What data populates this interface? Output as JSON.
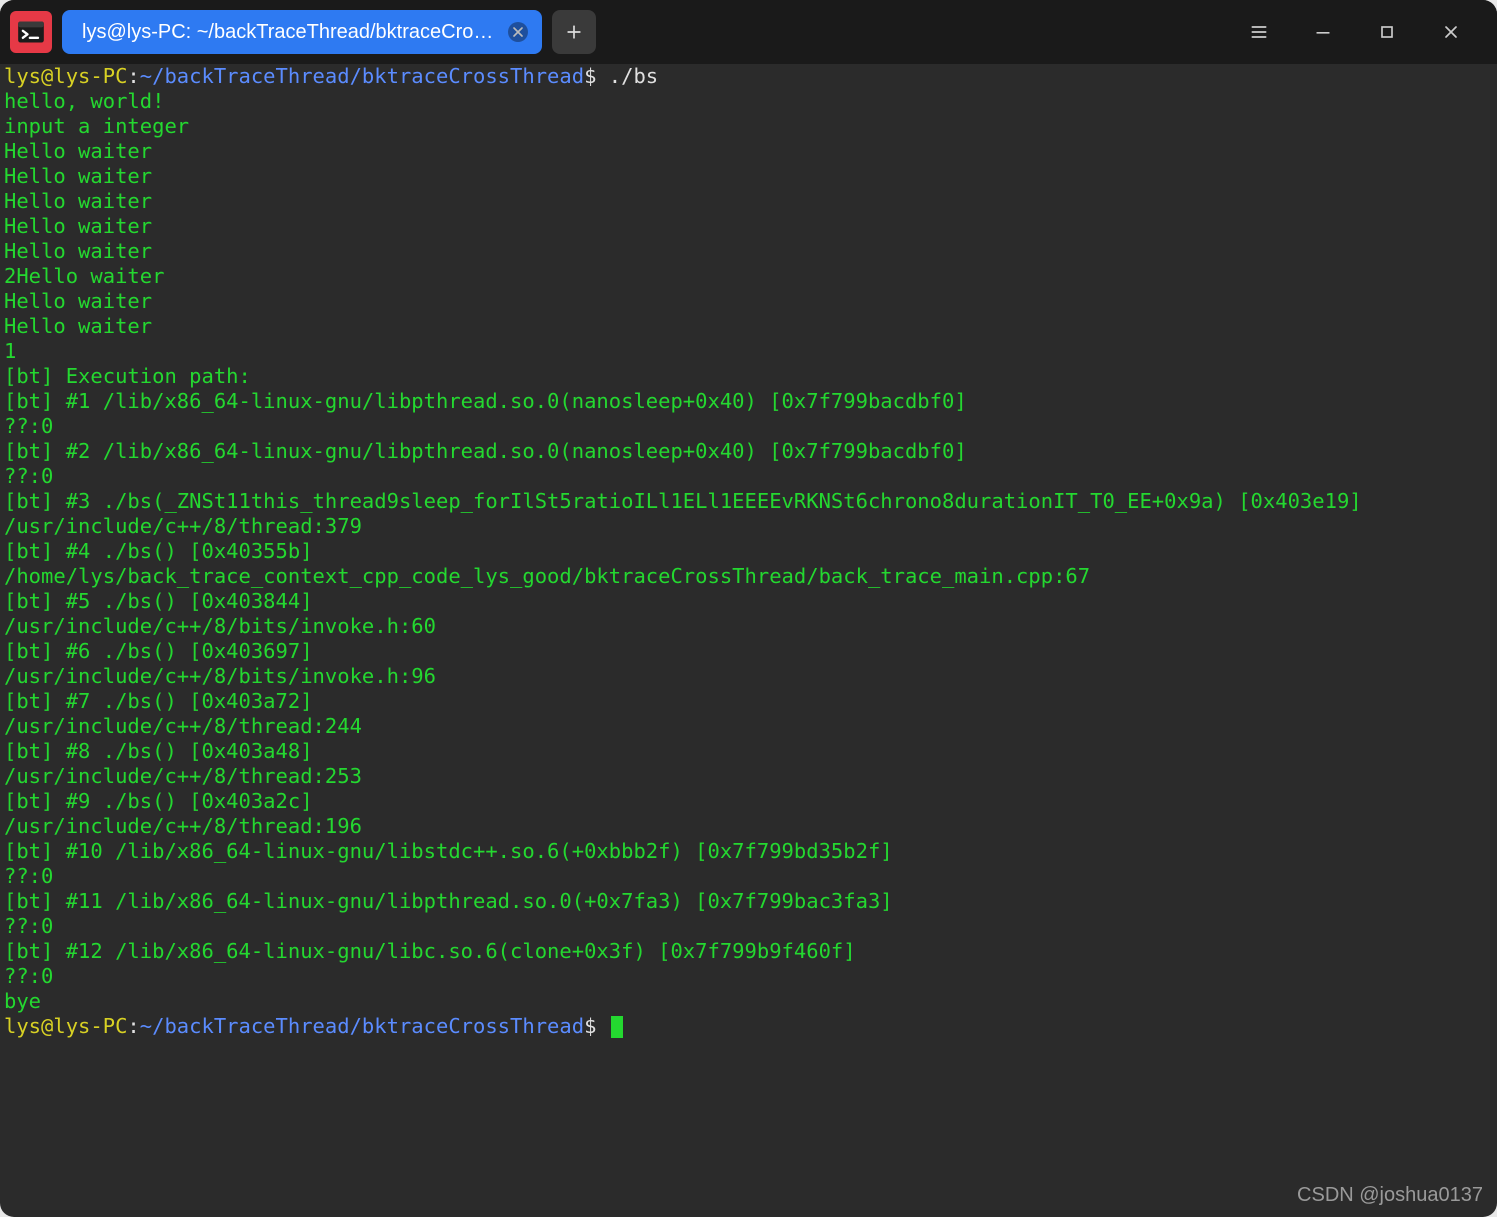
{
  "titlebar": {
    "tab_title": "lys@lys-PC: ~/backTraceThread/bktraceCrossThread",
    "new_tab_tooltip": "New tab"
  },
  "window_controls": {
    "menu": "Menu",
    "minimize": "Minimize",
    "maximize": "Maximize",
    "close": "Close"
  },
  "prompt": {
    "user_host": "lys@lys-PC",
    "colon": ":",
    "path": "~/backTraceThread/bktraceCrossThread",
    "dollar": "$"
  },
  "command": "./bs",
  "output_lines": [
    "hello, world!",
    "input a integer",
    "Hello waiter",
    "Hello waiter",
    "Hello waiter",
    "Hello waiter",
    "Hello waiter",
    "2Hello waiter",
    "Hello waiter",
    "Hello waiter",
    "1",
    "[bt] Execution path:",
    "[bt] #1 /lib/x86_64-linux-gnu/libpthread.so.0(nanosleep+0x40) [0x7f799bacdbf0]",
    "??:0",
    "[bt] #2 /lib/x86_64-linux-gnu/libpthread.so.0(nanosleep+0x40) [0x7f799bacdbf0]",
    "??:0",
    "[bt] #3 ./bs(_ZNSt11this_thread9sleep_forIlSt5ratioILl1ELl1EEEEvRKNSt6chrono8durationIT_T0_EE+0x9a) [0x403e19]",
    "/usr/include/c++/8/thread:379",
    "[bt] #4 ./bs() [0x40355b]",
    "/home/lys/back_trace_context_cpp_code_lys_good/bktraceCrossThread/back_trace_main.cpp:67",
    "[bt] #5 ./bs() [0x403844]",
    "/usr/include/c++/8/bits/invoke.h:60",
    "[bt] #6 ./bs() [0x403697]",
    "/usr/include/c++/8/bits/invoke.h:96",
    "[bt] #7 ./bs() [0x403a72]",
    "/usr/include/c++/8/thread:244",
    "[bt] #8 ./bs() [0x403a48]",
    "/usr/include/c++/8/thread:253",
    "[bt] #9 ./bs() [0x403a2c]",
    "/usr/include/c++/8/thread:196",
    "[bt] #10 /lib/x86_64-linux-gnu/libstdc++.so.6(+0xbbb2f) [0x7f799bd35b2f]",
    "??:0",
    "[bt] #11 /lib/x86_64-linux-gnu/libpthread.so.0(+0x7fa3) [0x7f799bac3fa3]",
    "??:0",
    "[bt] #12 /lib/x86_64-linux-gnu/libc.so.6(clone+0x3f) [0x7f799b9f460f]",
    "??:0",
    "bye"
  ],
  "watermark": "CSDN @joshua0137"
}
